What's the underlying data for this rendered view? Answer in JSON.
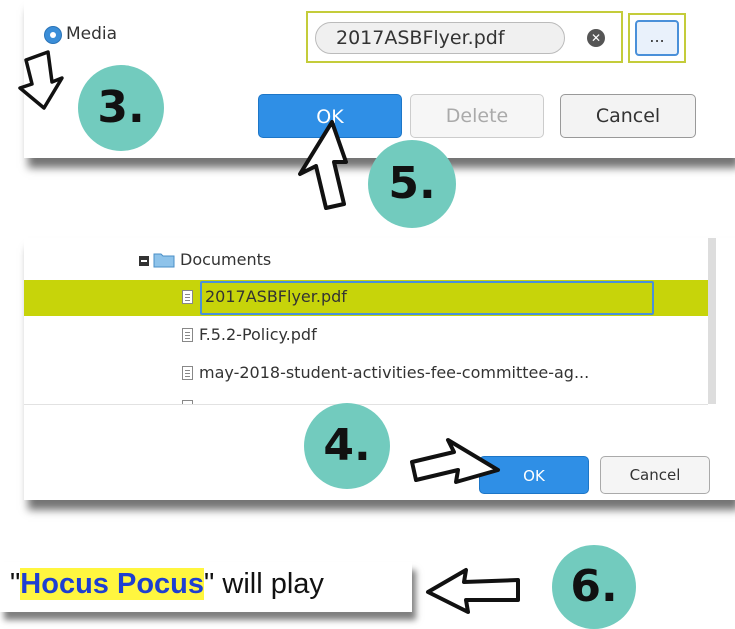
{
  "panel1": {
    "radio_label": "Media",
    "file_name": "2017ASBFlyer.pdf",
    "browse_label": "...",
    "ok_label": "OK",
    "delete_label": "Delete",
    "cancel_label": "Cancel"
  },
  "steps": {
    "step3": "3.",
    "step4": "4.",
    "step5": "5.",
    "step6": "6."
  },
  "file_browser": {
    "folder": "Documents",
    "files": [
      "2017ASBFlyer.pdf",
      "F.5.2-Policy.pdf",
      "may-2018-student-activities-fee-committee-ag..."
    ],
    "ok_label": "OK",
    "cancel_label": "Cancel"
  },
  "now_playing": {
    "quote_open": "\"",
    "title": "Hocus Pocus",
    "quote_close": "\"",
    "suffix": " will play"
  },
  "colors": {
    "accent_blue": "#2f8fe6",
    "highlight_row": "#c7d40a",
    "badge": "#72cbbe",
    "text_highlight": "#fff63f"
  }
}
